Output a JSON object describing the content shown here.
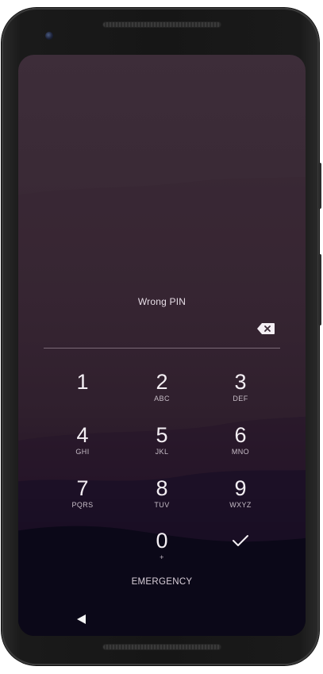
{
  "lockscreen": {
    "prompt": "Wrong PIN",
    "keys": [
      {
        "digit": "1",
        "letters": ""
      },
      {
        "digit": "2",
        "letters": "ABC"
      },
      {
        "digit": "3",
        "letters": "DEF"
      },
      {
        "digit": "4",
        "letters": "GHI"
      },
      {
        "digit": "5",
        "letters": "JKL"
      },
      {
        "digit": "6",
        "letters": "MNO"
      },
      {
        "digit": "7",
        "letters": "PQRS"
      },
      {
        "digit": "8",
        "letters": "TUV"
      },
      {
        "digit": "9",
        "letters": "WXYZ"
      },
      {
        "digit": "0",
        "letters": "+"
      }
    ],
    "emergency_label": "EMERGENCY"
  },
  "icons": {
    "backspace": "backspace-icon",
    "enter": "checkmark-icon",
    "nav_back": "back-triangle-icon"
  }
}
